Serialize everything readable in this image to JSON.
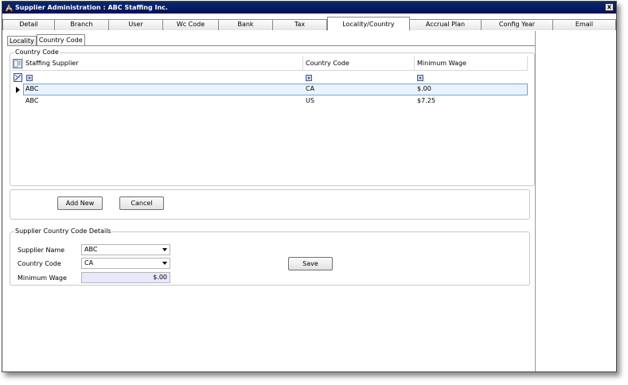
{
  "window": {
    "title": "Supplier Administration : ABC Staffing Inc.",
    "close_glyph": "x"
  },
  "tabs": [
    {
      "label": "Detail"
    },
    {
      "label": "Branch"
    },
    {
      "label": "User"
    },
    {
      "label": "Wc Code"
    },
    {
      "label": "Bank"
    },
    {
      "label": "Tax"
    },
    {
      "label": "Locality/Country",
      "active": true
    },
    {
      "label": "Accrual Plan"
    },
    {
      "label": "Config Year"
    },
    {
      "label": "Email"
    }
  ],
  "subtabs": [
    {
      "label": "Locality"
    },
    {
      "label": "Country Code",
      "active": true
    }
  ],
  "country_code_group": {
    "legend": "Country Code",
    "columns": [
      "Staffing Supplier",
      "Country Code",
      "Minimum Wage"
    ],
    "rows": [
      {
        "supplier": "ABC",
        "country": "CA",
        "wage": "$.00",
        "selected": true
      },
      {
        "supplier": "ABC",
        "country": "US",
        "wage": "$7.25",
        "selected": false
      }
    ]
  },
  "actions": {
    "add_new": "Add New",
    "cancel": "Cancel"
  },
  "details": {
    "legend": "Supplier Country Code Details",
    "supplier_name_label": "Supplier Name",
    "supplier_name_value": "ABC",
    "country_code_label": "Country Code",
    "country_code_value": "CA",
    "minimum_wage_label": "Minimum Wage",
    "minimum_wage_value": "$.00",
    "save": "Save"
  },
  "icons": {
    "app": "app-logo-icon",
    "column_chooser": "column-chooser-icon",
    "filter_clear": "filter-clear-icon",
    "row_indicator": "row-indicator-icon"
  },
  "colors": {
    "titlebar": "#0a2a6e",
    "selection_border": "#6aa7e0",
    "selection_fill": "#eaf3fd",
    "readonly_fill": "#e7e8fb"
  }
}
